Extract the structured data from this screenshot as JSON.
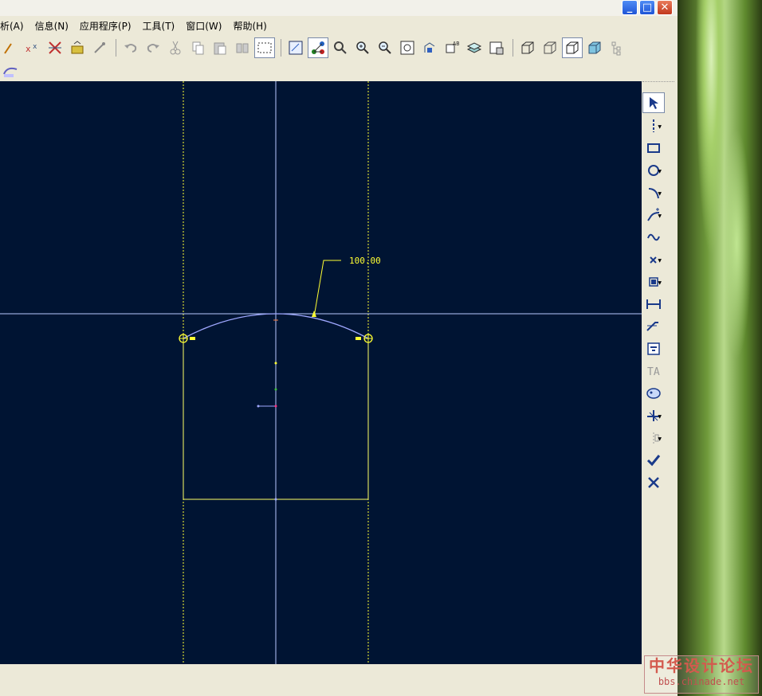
{
  "window": {
    "minimize_glyph": "_",
    "maximize_glyph": "□",
    "close_glyph": "✕"
  },
  "menu": [
    {
      "label": "析(A)"
    },
    {
      "label": "信息(N)"
    },
    {
      "label": "应用程序(P)"
    },
    {
      "label": "工具(T)"
    },
    {
      "label": "窗口(W)"
    },
    {
      "label": "帮助(H)"
    }
  ],
  "canvas": {
    "background": "#001433",
    "dimension_value": "100.00",
    "constraint_color": "#ffff33",
    "arc_color": "#9fa8ff"
  },
  "sketch_tools": [
    "select",
    "centerline",
    "rectangle",
    "circle",
    "arc",
    "fillet",
    "spline",
    "point",
    "offset",
    "dimension",
    "modify",
    "constraint",
    "text",
    "palette",
    "trim",
    "mirror",
    "done",
    "quit"
  ],
  "watermark": {
    "title": "中华设计论坛",
    "url": "bbs.chinade.net"
  }
}
